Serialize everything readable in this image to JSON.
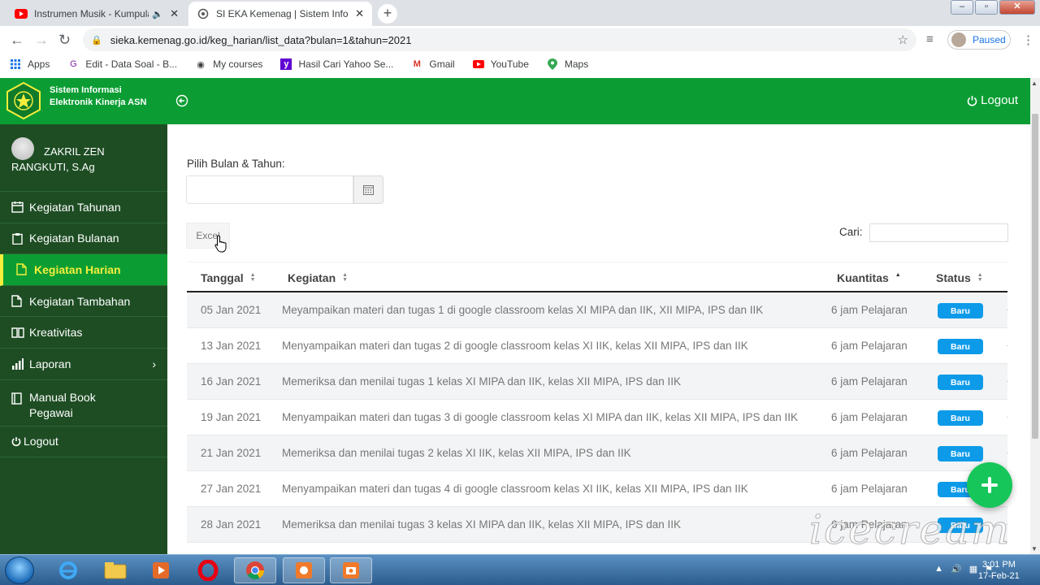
{
  "browser": {
    "tabs": [
      {
        "title": "Instrumen Musik - Kumpulan",
        "active": false
      },
      {
        "title": "SI EKA Kemenag | Sistem Informa",
        "active": true
      }
    ],
    "url": "sieka.kemenag.go.id/keg_harian/list_data?bulan=1&tahun=2021",
    "profile_status": "Paused",
    "bookmarks": [
      "Apps",
      "Edit - Data Soal - B...",
      "My courses",
      "Hasil Cari Yahoo Se...",
      "Gmail",
      "YouTube",
      "Maps"
    ]
  },
  "app": {
    "title_line1": "Sistem Informasi",
    "title_line2": "Elektronik Kinerja ASN",
    "logout_label": "Logout",
    "brand_color": "#0b9d33"
  },
  "sidebar": {
    "user_name": "ZAKRIL ZEN RANGKUTI, S.Ag",
    "items": [
      {
        "label": "Kegiatan Tahunan",
        "icon": "calendar-icon",
        "active": false
      },
      {
        "label": "Kegiatan Bulanan",
        "icon": "clipboard-icon",
        "active": false
      },
      {
        "label": "Kegiatan Harian",
        "icon": "file-icon",
        "active": true
      },
      {
        "label": "Kegiatan Tambahan",
        "icon": "file-icon",
        "active": false
      },
      {
        "label": "Kreativitas",
        "icon": "book-icon",
        "active": false
      },
      {
        "label": "Laporan",
        "icon": "bar-chart-icon",
        "active": false
      },
      {
        "label": "Manual Book Pegawai",
        "icon": "book-icon",
        "active": false
      },
      {
        "label": "Logout",
        "icon": "power-icon",
        "active": false
      }
    ]
  },
  "filter": {
    "label": "Pilih Bulan & Tahun:",
    "value": "",
    "excel_label": "Excel",
    "search_label": "Cari:",
    "search_value": ""
  },
  "table": {
    "columns": [
      "Tanggal",
      "Kegiatan",
      "Kuantitas",
      "Status"
    ],
    "rows": [
      {
        "date": "05 Jan 2021",
        "activity": "Meyampaikan materi dan tugas 1 di google classroom kelas XI MIPA dan IIK, XII MIPA, IPS dan IIK",
        "qty": "6 jam Pelajaran",
        "status": "Baru"
      },
      {
        "date": "13 Jan 2021",
        "activity": "Menyampaikan materi dan tugas 2 di google classroom kelas XI IIK, kelas XII MIPA, IPS dan IIK",
        "qty": "6 jam Pelajaran",
        "status": "Baru"
      },
      {
        "date": "16 Jan 2021",
        "activity": "Memeriksa dan menilai tugas 1 kelas XI MIPA dan IIK, kelas XII MIPA, IPS dan IIK",
        "qty": "6 jam Pelajaran",
        "status": "Baru"
      },
      {
        "date": "19 Jan 2021",
        "activity": "Menyampaikan materi dan tugas 3 di google classroom kelas XI MIPA dan IIK, kelas XII MIPA, IPS dan IIK",
        "qty": "6 jam Pelajaran",
        "status": "Baru"
      },
      {
        "date": "21 Jan 2021",
        "activity": "Memeriksa dan menilai tugas 2 kelas XI IIK, kelas XII MIPA, IPS dan IIK",
        "qty": "6 jam Pelajaran",
        "status": "Baru"
      },
      {
        "date": "27 Jan 2021",
        "activity": "Menyampaikan materi dan tugas 4 di google classroom kelas XI IIK, kelas XII MIPA, IPS dan IIK",
        "qty": "6 jam Pelajaran",
        "status": "Baru"
      },
      {
        "date": "28 Jan 2021",
        "activity": "Memeriksa dan menilai tugas 3 kelas XI MIPA dan IIK, kelas XII MIPA, IPS dan IIK",
        "qty": "6 jam Pelajaran",
        "status": "Baru"
      }
    ]
  },
  "taskbar": {
    "time": "3:01 PM",
    "date": "17-Feb-21"
  },
  "watermark": "icecream"
}
